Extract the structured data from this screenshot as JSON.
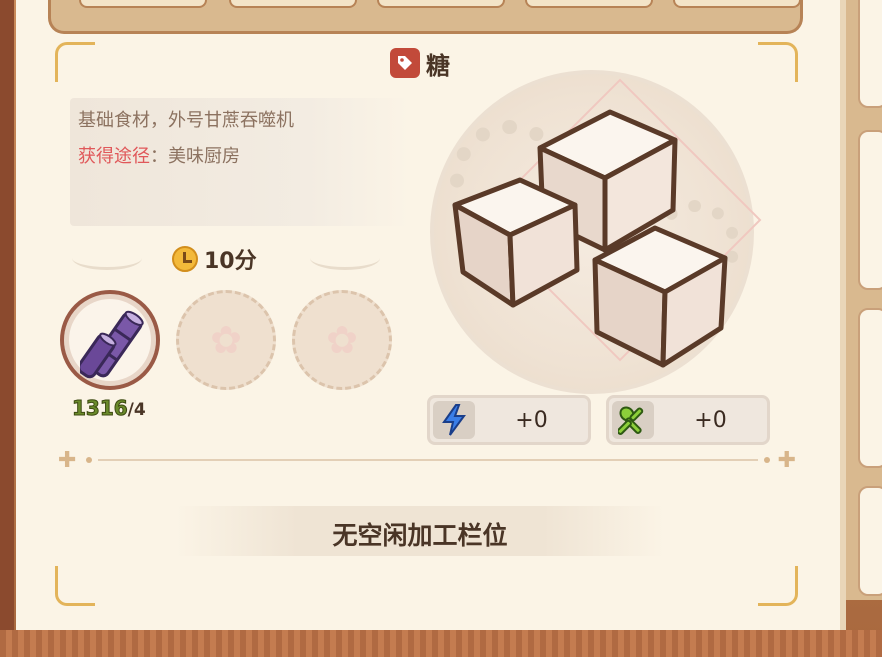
{
  "item": {
    "tag_icon": "tag-icon",
    "title": "糖",
    "description": "基础食材，外号甘蔗吞噬机",
    "source_label": "获得途径",
    "source_sep": "：",
    "source_value": "美味厨房"
  },
  "craft": {
    "clock_icon": "clock-icon",
    "time": "10分",
    "ingredients": [
      {
        "name": "sugarcane",
        "icon": "sugarcane-icon",
        "have": "1316",
        "need": "/4"
      },
      {
        "name": "empty",
        "icon": "sakura-icon"
      },
      {
        "name": "empty",
        "icon": "sakura-icon"
      }
    ]
  },
  "stats": [
    {
      "icon": "lightning-icon",
      "value": "+0"
    },
    {
      "icon": "utensils-icon",
      "value": "+0"
    }
  ],
  "status": "无空闲加工栏位",
  "colors": {
    "accent_red": "#e0585a",
    "title_brown": "#4a3526",
    "have_green": "#6a8a2a"
  }
}
